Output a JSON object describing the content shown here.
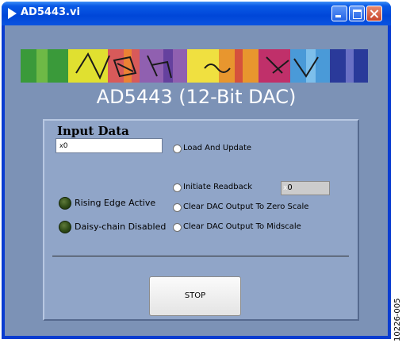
{
  "window": {
    "title": "AD5443.vi",
    "controls": [
      "minimize",
      "maximize",
      "close"
    ]
  },
  "app": {
    "heading": "AD5443 (12-Bit DAC)"
  },
  "input": {
    "label": "Input Data",
    "radix": "x",
    "value": "0"
  },
  "indicators": [
    {
      "label": "Rising Edge Active",
      "icon": "led-indicator-icon",
      "color": "#2f4b17"
    },
    {
      "label": "Daisy-chain Disabled",
      "icon": "led-indicator-icon",
      "color": "#2f4b17"
    }
  ],
  "actions": [
    {
      "label": "Load And Update"
    },
    {
      "label": "Initiate Readback"
    },
    {
      "label": "Clear DAC Output To Zero Scale"
    },
    {
      "label": "Clear DAC Output To Midscale"
    }
  ],
  "readback": {
    "radix": "x",
    "value": "0"
  },
  "stop_label": "STOP",
  "figure_id": "10226-005",
  "colors": {
    "titlebar": "#0a52e0",
    "client_bg": "#7c92b6",
    "panel_bg": "#90a5c8",
    "close_button": "#c8452a"
  }
}
